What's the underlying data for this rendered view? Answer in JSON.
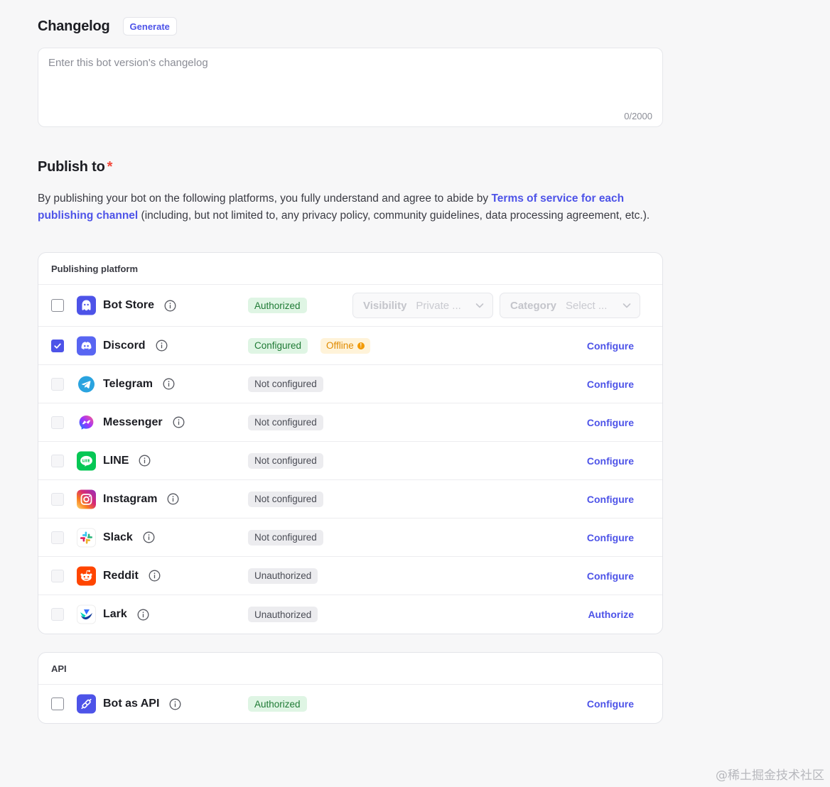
{
  "changelog": {
    "title": "Changelog",
    "generate_label": "Generate",
    "placeholder": "Enter this bot version's changelog",
    "counter": "0/2000"
  },
  "publish": {
    "title": "Publish to",
    "required_mark": "*",
    "desc_pre": "By publishing your bot on the following platforms, you fully understand and agree to abide by ",
    "desc_link": "Terms of service for each publishing channel",
    "desc_post": " (including, but not limited to, any privacy policy, community guidelines, data processing agreement, etc.).",
    "platform_header": "Publishing platform",
    "bot_store": {
      "name": "Bot Store",
      "status": "Authorized",
      "visibility_label": "Visibility",
      "visibility_value": "Private ...",
      "category_label": "Category",
      "category_value": "Select ..."
    },
    "discord": {
      "name": "Discord",
      "status": "Configured",
      "extra_status": "Offline",
      "action": "Configure"
    },
    "rows": [
      {
        "name": "Telegram",
        "status": "Not configured",
        "action": "Configure",
        "logo": "telegram-logo-icon"
      },
      {
        "name": "Messenger",
        "status": "Not configured",
        "action": "Configure",
        "logo": "messenger-logo-icon"
      },
      {
        "name": "LINE",
        "status": "Not configured",
        "action": "Configure",
        "logo": "line-logo-icon"
      },
      {
        "name": "Instagram",
        "status": "Not configured",
        "action": "Configure",
        "logo": "instagram-logo-icon"
      },
      {
        "name": "Slack",
        "status": "Not configured",
        "action": "Configure",
        "logo": "slack-logo-icon"
      },
      {
        "name": "Reddit",
        "status": "Unauthorized",
        "action": "Configure",
        "logo": "reddit-logo-icon"
      },
      {
        "name": "Lark",
        "status": "Unauthorized",
        "action": "Authorize",
        "logo": "lark-logo-icon"
      }
    ],
    "api_header": "API",
    "api": {
      "name": "Bot as API",
      "status": "Authorized",
      "action": "Configure"
    }
  },
  "watermark": "@稀土掘金技术社区",
  "colors": {
    "accent": "#4d53e8",
    "authorized_bg": "#dff5e4",
    "not_configured_bg": "#ececef",
    "offline": "#e08a00"
  }
}
